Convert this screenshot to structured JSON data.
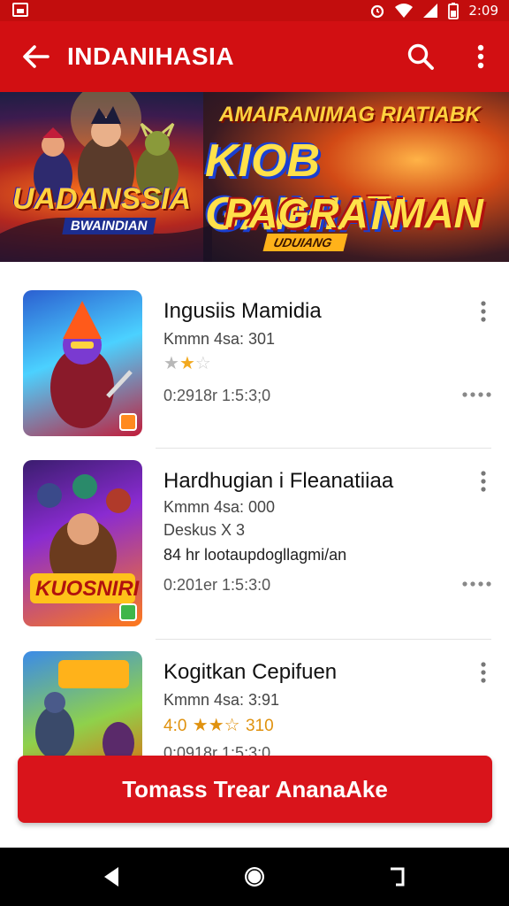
{
  "status_bar": {
    "time": "2:09",
    "icons": [
      "image-icon",
      "alarm-icon",
      "wifi-icon",
      "signal-icon",
      "battery-icon"
    ]
  },
  "app_bar": {
    "title": "INDANIHASIA",
    "background": "#d20f12",
    "icons": [
      "back-arrow-icon",
      "search-icon",
      "more-vert-icon"
    ]
  },
  "banner": {
    "logo_title": "UADANSSIA",
    "logo_subtitle": "BWAINDIAN",
    "headline_small": "AMAIRANIMAG RIATIABK",
    "headline_line1": "KIOB GAIMIAN",
    "headline_line2": "PAGRA¯MAN",
    "ribbon": "UDUIANG"
  },
  "items": [
    {
      "name": "Ingusiis Mamidia",
      "line1": "Kmmn 4sa: 301",
      "stars": 1.5,
      "time": "0:2918r 1:5:3;0",
      "thumb_colors": [
        "#2b5fd1",
        "#4bd1ff",
        "#c21d3a"
      ],
      "badge_color": "#ff8a1f"
    },
    {
      "name": "Hardhugian i Fleanatiiaa",
      "line1": "Kmmn 4sa: 000",
      "line2": "Deskus X 3",
      "line3": "84 hr lootaupdogllagmi/an",
      "time": "0:201er 1:5:3:0",
      "thumb_colors": [
        "#3a1d6e",
        "#ff7a1a",
        "#8a2bd1"
      ],
      "badge_color": "#3fb64a"
    },
    {
      "name": "Kogitkan Cepifuen",
      "line1": "Kmmn 4sa: 3:91",
      "rating_text": "4:0",
      "rating_count": "310",
      "stars": 3.5,
      "time": "0:0918r 1:5:3:0",
      "thumb_colors": [
        "#3b8be8",
        "#8fd14b",
        "#d27a1a"
      ]
    }
  ],
  "cta": {
    "label": "Tomass Trear AnanaAke",
    "color": "#d9141b"
  },
  "nav_bar": {
    "icons": [
      "back-triangle-icon",
      "home-circle-icon",
      "recents-icon"
    ]
  }
}
